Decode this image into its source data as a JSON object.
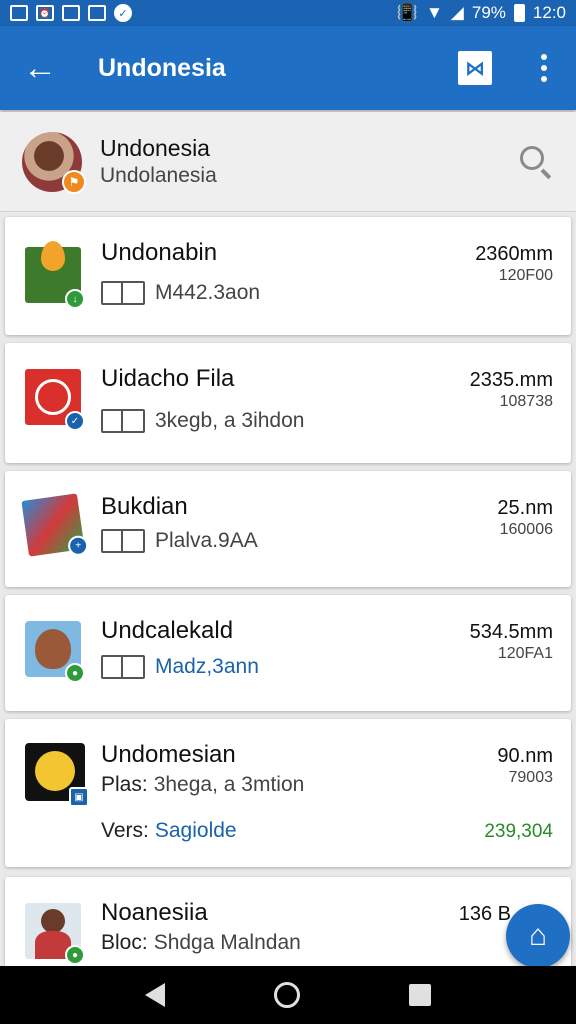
{
  "status": {
    "battery": "79%",
    "time": "12:0"
  },
  "appbar": {
    "title": "Undonesia"
  },
  "account": {
    "name": "Undonesia",
    "subtitle": "Undolanesia"
  },
  "items": [
    {
      "title": "Undonabin",
      "meta_label": "",
      "meta_value": "M442.3aon",
      "size": "2360mm",
      "sub": "120F00",
      "badge_color": "#2e9b3a"
    },
    {
      "title": "Uidacho Fila",
      "meta_label": "",
      "meta_value": "3kegb, a 3ihdon",
      "size": "2335.mm",
      "sub": "108738",
      "badge_color": "#1a62ab"
    },
    {
      "title": "Bukdian",
      "meta_label": "",
      "meta_value": "Plalva.9AA",
      "size": "25.nm",
      "sub": "160006",
      "badge_color": "#1a62ab"
    },
    {
      "title": "Undcalekald",
      "meta_label": "",
      "meta_value": "Madz,3ann",
      "size": "534.5mm",
      "sub": "120FA1",
      "badge_color": "#2e9b3a"
    },
    {
      "title": "Undomesian",
      "meta_label": "Plas:",
      "meta_value": "3hega, a 3mtion",
      "meta2_label": "Vers:",
      "meta2_value": "Sagiolde",
      "size": "90.nm",
      "sub": "79003",
      "green": "239,304",
      "badge_color": "#1a62ab"
    },
    {
      "title": "Noanesiia",
      "meta_label": "Bloc:",
      "meta_value": "Shdga Malndan",
      "size": "136 B",
      "badge_color": "#2e9b3a"
    }
  ]
}
